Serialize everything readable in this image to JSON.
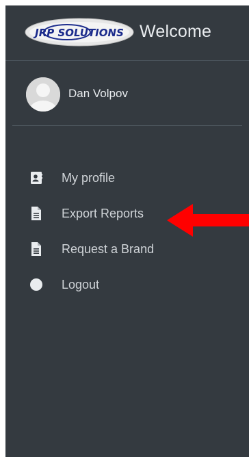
{
  "brand": {
    "logo_text": "JRP SOLUTIONS",
    "title": "Welcome"
  },
  "user": {
    "name": "Dan Volpov"
  },
  "nav": {
    "items": [
      {
        "label": "My profile",
        "icon": "contact-card-icon"
      },
      {
        "label": "Export Reports",
        "icon": "document-icon"
      },
      {
        "label": "Request a Brand",
        "icon": "document-icon"
      },
      {
        "label": "Logout",
        "icon": "circle-icon"
      }
    ]
  },
  "colors": {
    "sidebar_bg": "#343a40",
    "text": "#d0d4d8",
    "arrow": "#ff0000"
  }
}
